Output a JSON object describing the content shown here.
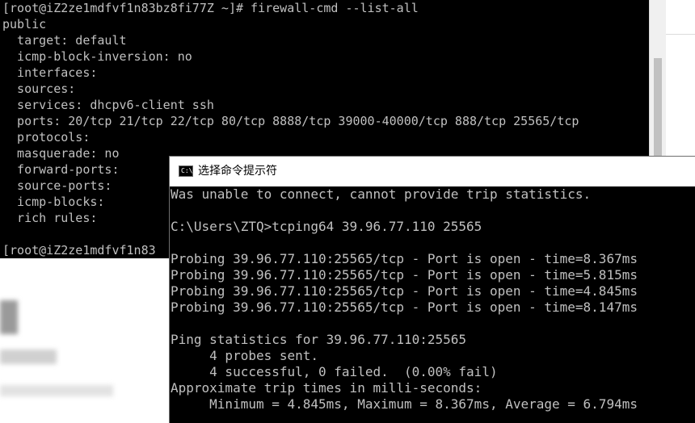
{
  "linux_terminal": {
    "lines": [
      "[root@iZ2ze1mdfvf1n83bz8fi77Z ~]# firewall-cmd --list-all",
      "public",
      "  target: default",
      "  icmp-block-inversion: no",
      "  interfaces:",
      "  sources:",
      "  services: dhcpv6-client ssh",
      "  ports: 20/tcp 21/tcp 22/tcp 80/tcp 8888/tcp 39000-40000/tcp 888/tcp 25565/tcp",
      "  protocols:",
      "  masquerade: no",
      "  forward-ports:",
      "  source-ports:",
      "  icmp-blocks:",
      "  rich rules:",
      "",
      "[root@iZ2ze1mdfvf1n83"
    ]
  },
  "cmd_window": {
    "title": "选择命令提示符",
    "icon": "cmd-icon",
    "lines": [
      "Was unable to connect, cannot provide trip statistics.",
      "",
      "C:\\Users\\ZTQ>tcping64 39.96.77.110 25565",
      "",
      "Probing 39.96.77.110:25565/tcp - Port is open - time=8.367ms",
      "Probing 39.96.77.110:25565/tcp - Port is open - time=5.815ms",
      "Probing 39.96.77.110:25565/tcp - Port is open - time=4.845ms",
      "Probing 39.96.77.110:25565/tcp - Port is open - time=8.147ms",
      "",
      "Ping statistics for 39.96.77.110:25565",
      "     4 probes sent.",
      "     4 successful, 0 failed.  (0.00% fail)",
      "Approximate trip times in milli-seconds:",
      "     Minimum = 4.845ms, Maximum = 8.367ms, Average = 6.794ms"
    ]
  },
  "colors": {
    "terminal_bg": "#000000",
    "terminal_text": "#c0c0c0",
    "titlebar_bg": "#ffffff"
  }
}
